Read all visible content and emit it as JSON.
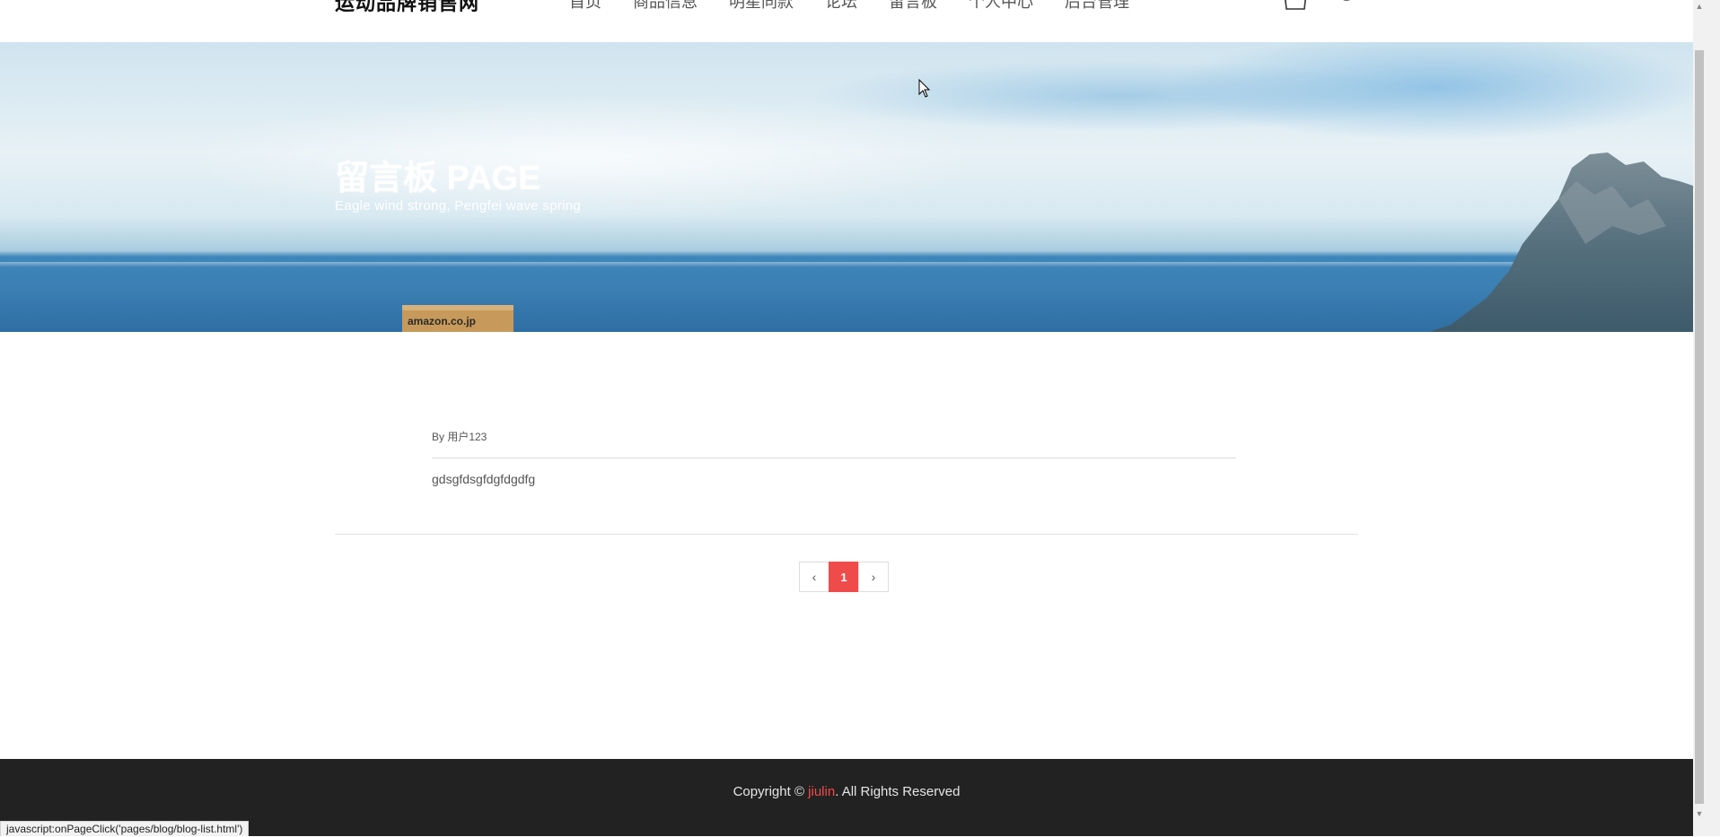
{
  "header": {
    "logo": "运动品牌销售网",
    "nav": [
      "首页",
      "商品信息",
      "明星同款",
      "论坛",
      "留言板",
      "个人中心",
      "后台管理"
    ]
  },
  "hero": {
    "title": "留言板 PAGE",
    "subtitle": "Eagle wind strong, Pengfei wave spring",
    "box_label": "amazon.co.jp"
  },
  "post": {
    "author": "By 用户123",
    "content": "gdsgfdsgfdgfdgdfg"
  },
  "pagination": {
    "prev": "‹",
    "current": "1",
    "next": "›"
  },
  "footer": {
    "prefix": "Copyright © ",
    "brand": "jiulin",
    "suffix": ". All Rights Reserved"
  },
  "status_bar": "javascript:onPageClick('pages/blog/blog-list.html')",
  "colors": {
    "accent": "#f04b4b",
    "footer_bg": "#222222"
  }
}
